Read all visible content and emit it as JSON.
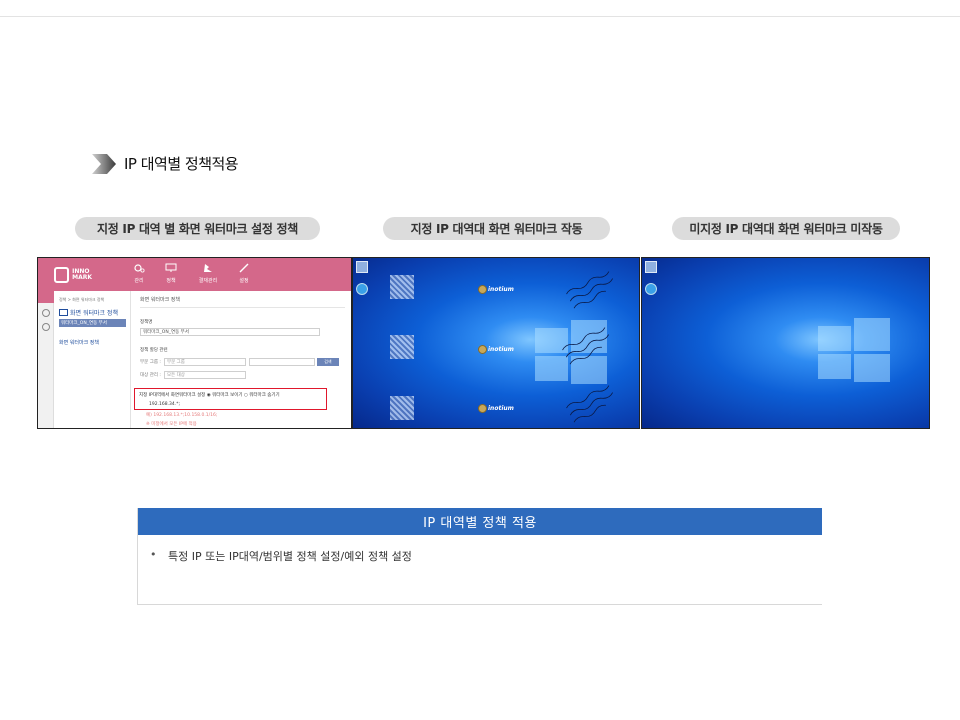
{
  "section": {
    "title": "IP 대역별 정책적용"
  },
  "pills": [
    {
      "label": "지정 IP 대역 별 화면 워터마크 설정 정책"
    },
    {
      "label": "지정 IP 대역대 화면 워터마크 작동"
    },
    {
      "label": "미지정 IP 대역대 화면 워터마크 미작동"
    }
  ],
  "admin": {
    "brand_line1": "INNO",
    "brand_line2": "MARK",
    "menu": [
      "관리",
      "정책",
      "결재관리",
      "설정"
    ],
    "breadcrumb": "정책 > 화면 워터마크 정책",
    "tree_root": "화면 워터마크 정책",
    "tree_selected": "워터마크_ON_연동 부서",
    "tree_item2": "화면 워터마크 정책",
    "panel_title": "화면 워터마크 정책",
    "policy_name_label": "정책명",
    "policy_name_value": "워터마크_ON_연동 부서",
    "scope_label": "정책 할당 관련",
    "group_label": "부문 그룹 :",
    "group_value": "부문 그룹",
    "target_label": "대상 관리 :",
    "target_value": "모든 대상",
    "apply_button": "검색",
    "ip_option_text": "지정 IP대역에서 화면워터마크 설정   ◉ 워터마크 보이기   ○ 워터마크 숨기기",
    "ip_value": "192.168.34.*;",
    "note1": "예) 192.168.13.*;10.158.0.1/16;",
    "note2": "※ 미정에서 모든 IP에 적용"
  },
  "watermark": {
    "brand": "inotium"
  },
  "info": {
    "header": "IP 대역별 정책 적용",
    "bullet": "•",
    "text": "특정 IP 또는 IP대역/범위별 정책 설정/예외 정책 설정"
  }
}
